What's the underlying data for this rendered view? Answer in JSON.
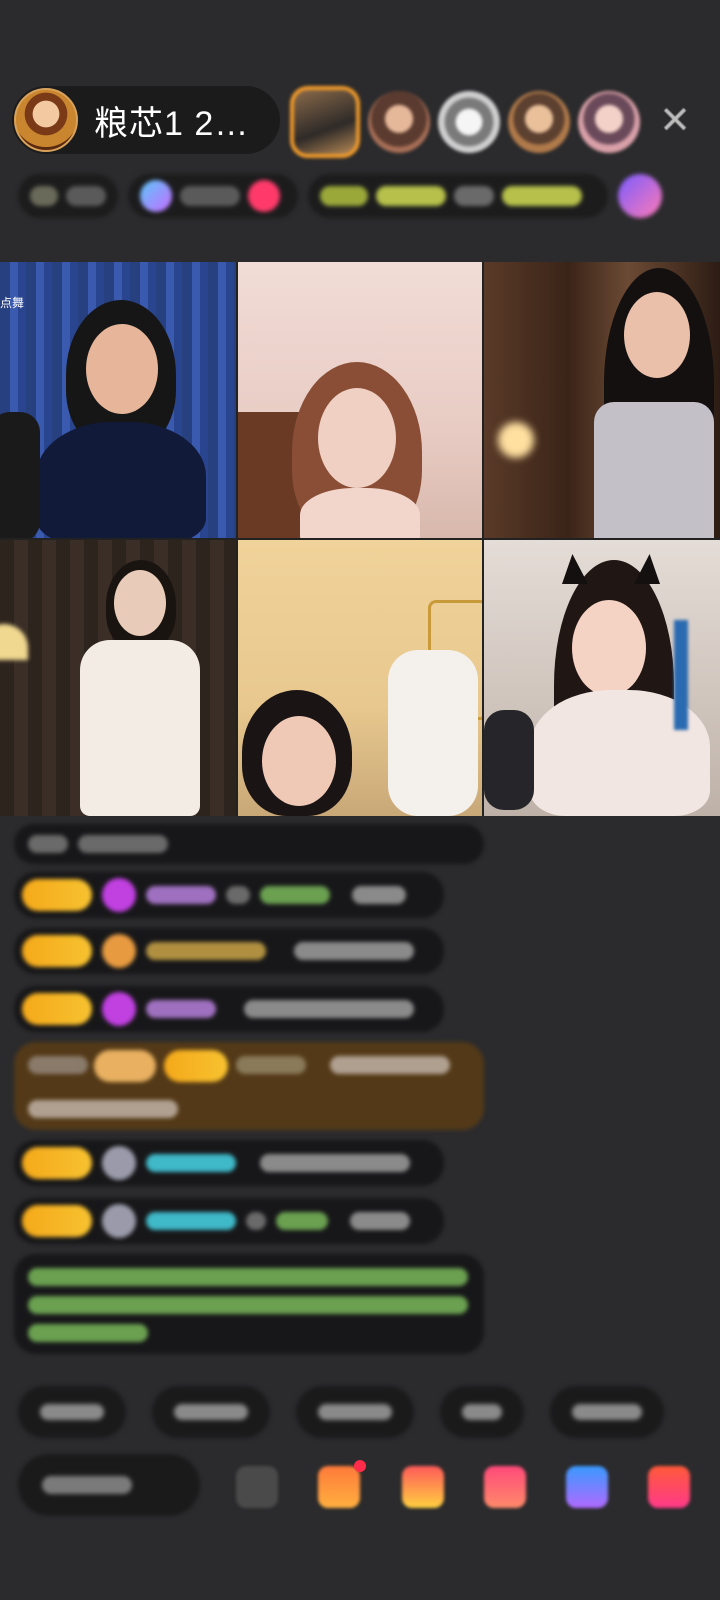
{
  "host": {
    "name": "粮芯1 2…",
    "avatar_icon": "host-avatar-image"
  },
  "viewers": {
    "icons": [
      "top-viewer-avatar",
      "viewer-avatar",
      "viewer-avatar",
      "viewer-avatar",
      "viewer-avatar"
    ],
    "close_glyph": "✕"
  },
  "grid": {
    "tile_tag": "点舞"
  },
  "colors": {
    "background": "#2b2b2d",
    "level_badge": "#f5a91a",
    "highlight_ring": "#f29b2a",
    "chat_green": "#7cc26a",
    "chat_cyan": "#3fb8c8",
    "gem_purple": "#c040e0"
  },
  "bottom_bar": {
    "icons": [
      "emoji-icon",
      "gift-box-icon",
      "gift-bag-icon",
      "heart-icon",
      "share-icon",
      "more-icon"
    ]
  }
}
